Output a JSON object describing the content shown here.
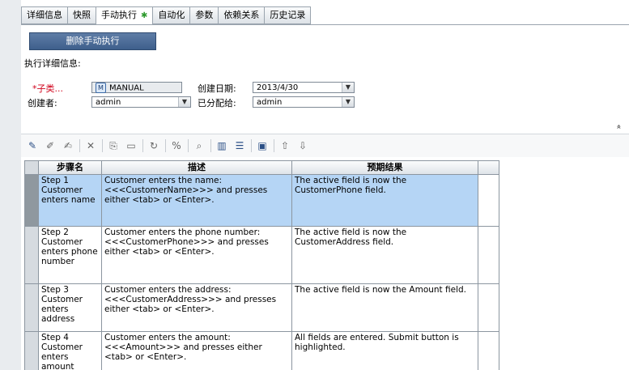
{
  "tabs": [
    {
      "label": "详细信息",
      "active": false
    },
    {
      "label": "快照",
      "active": false
    },
    {
      "label": "手动执行",
      "active": true,
      "indicator": "✱"
    },
    {
      "label": "自动化",
      "active": false
    },
    {
      "label": "参数",
      "active": false
    },
    {
      "label": "依赖关系",
      "active": false
    },
    {
      "label": "历史记录",
      "active": false
    }
  ],
  "actions": {
    "delete_manual_label": "删除手动执行"
  },
  "details": {
    "section_title": "执行详细信息:",
    "required_marker": "*",
    "subtype_label": "子类...",
    "subtype_value": "MANUAL",
    "subtype_badge": "M",
    "created_date_label": "创建日期:",
    "created_date_value": "2013/4/30",
    "creator_label": "创建者:",
    "creator_value": "admin",
    "assigned_label": "已分配给:",
    "assigned_value": "admin"
  },
  "collapse_glyph": "«",
  "toolbar": {
    "icons": [
      "new-step-icon",
      "edit-icon",
      "renumber-icon",
      "delete-icon",
      "copy-icon",
      "paste-icon",
      "call-test-icon",
      "parameter-icon",
      "find-icon",
      "select-columns-icon",
      "grid-filter-icon",
      "save-icon",
      "move-up-icon",
      "move-down-icon"
    ]
  },
  "steps_table": {
    "columns": [
      "步骤名",
      "描述",
      "预期结果"
    ],
    "rows": [
      {
        "name": "Step 1 Customer enters name",
        "description": "Customer enters the name: <<<CustomerName>>> and presses either <tab> or <Enter>.",
        "expected": "The active field is now the CustomerPhone field.",
        "selected": true
      },
      {
        "name": "Step 2 Customer enters phone number",
        "description": "Customer enters the phone number: <<<CustomerPhone>>> and presses either <tab> or <Enter>.",
        "expected": "The active field is now the CustomerAddress field.",
        "selected": false
      },
      {
        "name": "Step 3 Customer enters address",
        "description": "Customer enters the address: <<<CustomerAddress>>> and presses either <tab> or <Enter>.",
        "expected": " The active field is now the Amount field.",
        "selected": false
      },
      {
        "name": "Step 4 Customer enters amount",
        "description": "Customer enters the amount: <<<Amount>>> and presses either <tab> or <Enter>.",
        "expected": "All fields are entered. Submit button is highlighted.",
        "selected": false
      }
    ]
  }
}
